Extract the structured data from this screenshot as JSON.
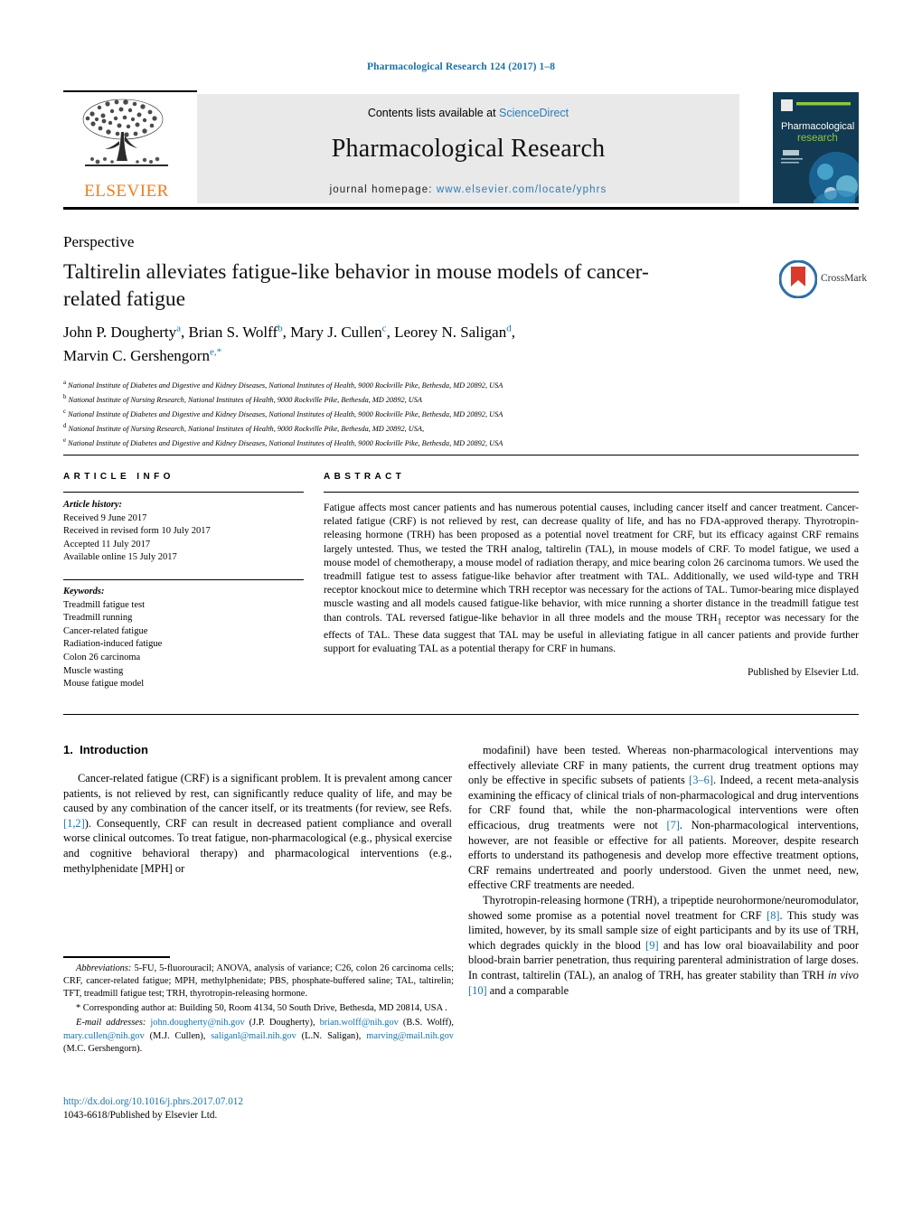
{
  "running_head": "Pharmacological Research 124 (2017) 1–8",
  "masthead": {
    "publisher_name": "ELSEVIER",
    "contents_prefix": "Contents lists available at ",
    "contents_link": "ScienceDirect",
    "journal_name": "Pharmacological Research",
    "homepage_prefix": "journal homepage: ",
    "homepage_url": "www.elsevier.com/locate/yphrs",
    "cover_title_line1": "Pharmacological",
    "cover_title_line2": "research"
  },
  "article": {
    "type": "Perspective",
    "title": "Taltirelin alleviates fatigue-like behavior in mouse models of cancer-related fatigue",
    "crossmark_label": "CrossMark",
    "authors": [
      {
        "name": "John P. Dougherty",
        "sup": "a"
      },
      {
        "name": "Brian S. Wolff",
        "sup": "b"
      },
      {
        "name": "Mary J. Cullen",
        "sup": "c"
      },
      {
        "name": "Leorey N. Saligan",
        "sup": "d"
      },
      {
        "name": "Marvin C. Gershengorn",
        "sup": "e,*"
      }
    ],
    "affiliations": [
      {
        "mark": "a",
        "text": "National Institute of Diabetes and Digestive and Kidney Diseases, National Institutes of Health, 9000 Rockville Pike, Bethesda, MD 20892, USA"
      },
      {
        "mark": "b",
        "text": "National Institute of Nursing Research, National Institutes of Health, 9000 Rockville Pike, Bethesda, MD 20892, USA"
      },
      {
        "mark": "c",
        "text": "National Institute of Diabetes and Digestive and Kidney Diseases, National Institutes of Health, 9000 Rockville Pike, Bethesda, MD 20892, USA"
      },
      {
        "mark": "d",
        "text": "National Institute of Nursing Research, National Institutes of Health, 9000 Rockville Pike, Bethesda, MD 20892, USA,"
      },
      {
        "mark": "e",
        "text": "National Institute of Diabetes and Digestive and Kidney Diseases, National Institutes of Health, 9000 Rockville Pike, Bethesda, MD 20892, USA"
      }
    ]
  },
  "article_info": {
    "heading": "ARTICLE INFO",
    "history_label": "Article history:",
    "history": [
      "Received 9 June 2017",
      "Received in revised form 10 July 2017",
      "Accepted 11 July 2017",
      "Available online 15 July 2017"
    ],
    "keywords_label": "Keywords:",
    "keywords": [
      "Treadmill fatigue test",
      "Treadmill running",
      "Cancer-related fatigue",
      "Radiation-induced fatigue",
      "Colon 26 carcinoma",
      "Muscle wasting",
      "Mouse fatigue model"
    ]
  },
  "abstract": {
    "heading": "ABSTRACT",
    "text": "Fatigue affects most cancer patients and has numerous potential causes, including cancer itself and cancer treatment. Cancer-related fatigue (CRF) is not relieved by rest, can decrease quality of life, and has no FDA-approved therapy. Thyrotropin-releasing hormone (TRH) has been proposed as a potential novel treatment for CRF, but its efficacy against CRF remains largely untested. Thus, we tested the TRH analog, taltirelin (TAL), in mouse models of CRF. To model fatigue, we used a mouse model of chemotherapy, a mouse model of radiation therapy, and mice bearing colon 26 carcinoma tumors. We used the treadmill fatigue test to assess fatigue-like behavior after treatment with TAL. Additionally, we used wild-type and TRH receptor knockout mice to determine which TRH receptor was necessary for the actions of TAL. Tumor-bearing mice displayed muscle wasting and all models caused fatigue-like behavior, with mice running a shorter distance in the treadmill fatigue test than controls. TAL reversed fatigue-like behavior in all three models and the mouse TRH1 receptor was necessary for the effects of TAL. These data suggest that TAL may be useful in alleviating fatigue in all cancer patients and provide further support for evaluating TAL as a potential therapy for CRF in humans.",
    "publisher_note": "Published by Elsevier Ltd."
  },
  "body": {
    "section_number": "1.",
    "section_title": "Introduction",
    "left_paragraphs": [
      "Cancer-related fatigue (CRF) is a significant problem. It is prevalent among cancer patients, is not relieved by rest, can significantly reduce quality of life, and may be caused by any combination of the cancer itself, or its treatments (for review, see Refs. [1,2]). Consequently, CRF can result in decreased patient compliance and overall worse clinical outcomes. To treat fatigue, non-pharmacological (e.g., physical exercise and cognitive behavioral therapy) and pharmacological interventions (e.g., methylphenidate [MPH] or"
    ],
    "right_paragraphs": [
      "modafinil) have been tested. Whereas non-pharmacological interventions may effectively alleviate CRF in many patients, the current drug treatment options may only be effective in specific subsets of patients [3–6]. Indeed, a recent meta-analysis examining the efficacy of clinical trials of non-pharmacological and drug interventions for CRF found that, while the non-pharmacological interventions were often efficacious, drug treatments were not [7]. Non-pharmacological interventions, however, are not feasible or effective for all patients. Moreover, despite research efforts to understand its pathogenesis and develop more effective treatment options, CRF remains undertreated and poorly understood. Given the unmet need, new, effective CRF treatments are needed.",
      "Thyrotropin-releasing hormone (TRH), a tripeptide neurohormone/neuromodulator, showed some promise as a potential novel treatment for CRF [8]. This study was limited, however, by its small sample size of eight participants and by its use of TRH, which degrades quickly in the blood [9] and has low oral bioavailability and poor blood-brain barrier penetration, thus requiring parenteral administration of large doses. In contrast, taltirelin (TAL), an analog of TRH, has greater stability than TRH in vivo [10] and a comparable"
    ]
  },
  "footnotes": {
    "abbrev_label": "Abbreviations:",
    "abbrev_text": " 5-FU, 5-fluorouracil; ANOVA, analysis of variance; C26, colon 26 carcinoma cells; CRF, cancer-related fatigue; MPH, methylphenidate; PBS, phosphate-buffered saline; TAL, taltirelin; TFT, treadmill fatigue test; TRH, thyrotropin-releasing hormone.",
    "corresponding_text": "* Corresponding author at: Building 50, Room 4134, 50 South Drive, Bethesda, MD 20814, USA .",
    "email_label": "E-mail addresses:",
    "emails": [
      {
        "address": "john.dougherty@nih.gov",
        "owner": "(J.P. Dougherty)"
      },
      {
        "address": "brian.wolff@nih.gov",
        "owner": "(B.S. Wolff)"
      },
      {
        "address": "mary.cullen@nih.gov",
        "owner": "(M.J. Cullen)"
      },
      {
        "address": "saliganl@mail.nih.gov",
        "owner": "(L.N. Saligan)"
      },
      {
        "address": "marving@mail.nih.gov",
        "owner": "(M.C. Gershengorn)"
      }
    ]
  },
  "doi_block": {
    "doi_url": "http://dx.doi.org/10.1016/j.phrs.2017.07.012",
    "issn_line": "1043-6618/Published by Elsevier Ltd."
  },
  "colors": {
    "link_blue": "#1a72a8",
    "elsevier_orange": "#ef7d1a",
    "masthead_grey": "#e9e9e9",
    "cover_navy": "#123a52",
    "crossmark_red": "#d93a2b"
  }
}
